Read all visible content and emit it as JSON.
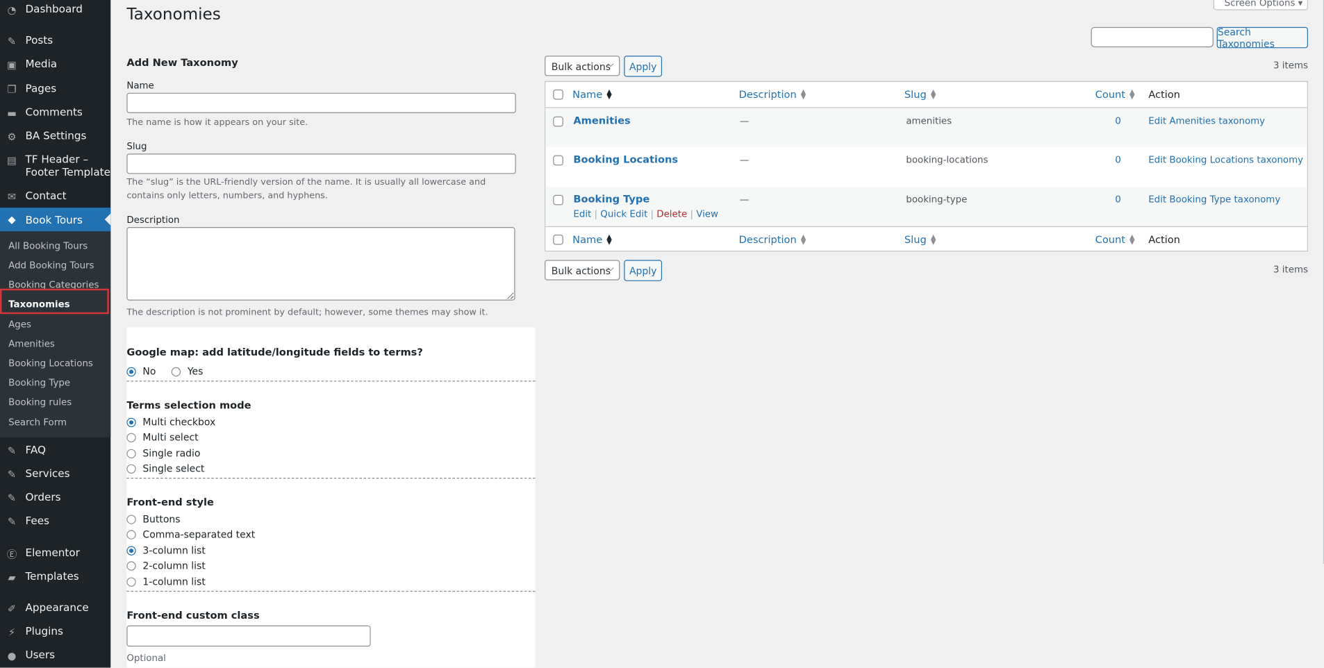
{
  "page": {
    "title": "Taxonomies",
    "screen_options": "Screen Options ▾"
  },
  "search": {
    "button_label": "Search Taxonomies",
    "value": ""
  },
  "sidebar": {
    "items": [
      {
        "label": "Dashboard",
        "icon": "dashboard-icon"
      },
      {
        "label": "Posts",
        "icon": "pin-icon"
      },
      {
        "label": "Media",
        "icon": "media-icon"
      },
      {
        "label": "Pages",
        "icon": "pages-icon"
      },
      {
        "label": "Comments",
        "icon": "comments-icon"
      },
      {
        "label": "BA Settings",
        "icon": "gear-icon"
      },
      {
        "label": "TF Header –\nFooter Template",
        "icon": "document-icon"
      },
      {
        "label": "Contact",
        "icon": "mail-icon"
      },
      {
        "label": "Book Tours",
        "icon": "tag-icon"
      },
      {
        "label": "FAQ",
        "icon": "pin-icon"
      },
      {
        "label": "Services",
        "icon": "pin-icon"
      },
      {
        "label": "Orders",
        "icon": "pin-icon"
      },
      {
        "label": "Fees",
        "icon": "pin-icon"
      },
      {
        "label": "Elementor",
        "icon": "elementor-icon"
      },
      {
        "label": "Templates",
        "icon": "folder-icon"
      },
      {
        "label": "Appearance",
        "icon": "brush-icon"
      },
      {
        "label": "Plugins",
        "icon": "plug-icon"
      },
      {
        "label": "Users",
        "icon": "user-icon"
      }
    ],
    "submenu": [
      "All Booking Tours",
      "Add Booking Tours",
      "Booking Categories",
      "Taxonomies",
      "Ages",
      "Amenities",
      "Booking Locations",
      "Booking Type",
      "Booking rules",
      "Search Form"
    ]
  },
  "form": {
    "heading": "Add New Taxonomy",
    "name_label": "Name",
    "name_value": "",
    "name_help": "The name is how it appears on your site.",
    "slug_label": "Slug",
    "slug_value": "",
    "slug_help": "The “slug” is the URL-friendly version of the name. It is usually all lowercase and contains only letters, numbers, and hyphens.",
    "description_label": "Description",
    "description_value": "",
    "description_help": "The description is not prominent by default; however, some themes may show it.",
    "google_map": {
      "title": "Google map: add latitude/longitude fields to terms?",
      "options": [
        "No",
        "Yes"
      ],
      "selected": "No"
    },
    "terms_mode": {
      "title": "Terms selection mode",
      "options": [
        "Multi checkbox",
        "Multi select",
        "Single radio",
        "Single select"
      ],
      "selected": "Multi checkbox"
    },
    "frontend_style": {
      "title": "Front-end style",
      "options": [
        "Buttons",
        "Comma-separated text",
        "3-column list",
        "2-column list",
        "1-column list"
      ],
      "selected": "3-column list"
    },
    "custom_class": {
      "title": "Front-end custom class",
      "value": "",
      "help": "Optional"
    }
  },
  "table": {
    "bulk_label": "Bulk actions",
    "apply_label": "Apply",
    "items_count": "3 items",
    "columns": [
      "Name",
      "Description",
      "Slug",
      "Count",
      "Action"
    ],
    "rows": [
      {
        "name": "Amenities",
        "description": "—",
        "slug": "amenities",
        "count": "0",
        "action": "Edit Amenities taxonomy"
      },
      {
        "name": "Booking Locations",
        "description": "—",
        "slug": "booking-locations",
        "count": "0",
        "action": "Edit Booking Locations taxonomy"
      },
      {
        "name": "Booking Type",
        "description": "—",
        "slug": "booking-type",
        "count": "0",
        "action": "Edit Booking Type taxonomy"
      }
    ],
    "row_actions": [
      "Edit",
      "Quick Edit",
      "Delete",
      "View"
    ]
  }
}
